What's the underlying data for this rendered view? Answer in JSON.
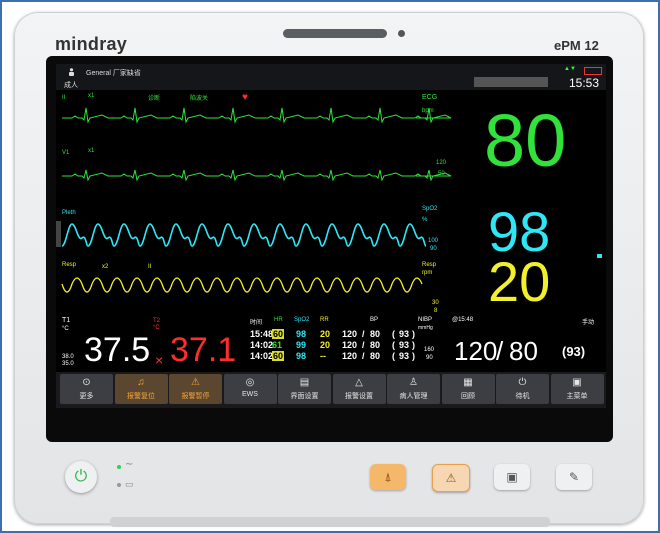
{
  "device": {
    "brand": "mindray",
    "model": "ePM 12"
  },
  "status_bar": {
    "patient_type": "成人",
    "bed_label": "General 厂家缺省",
    "time": "15:53"
  },
  "ecg": {
    "lead1": "II",
    "gain1": "x1",
    "filter": "诊断",
    "notch": "陷波关",
    "lead2": "V1",
    "gain2": "x1",
    "label": "ECG",
    "unit": "bpm",
    "upper": "120",
    "lower": "50",
    "hr": "80"
  },
  "spo2": {
    "wave_label": "Pleth",
    "label": "SpO2",
    "unit": "%",
    "upper": "100",
    "lower": "90",
    "value": "98"
  },
  "resp": {
    "wave_label": "Resp",
    "gain": "x2",
    "lead": "II",
    "label": "Resp",
    "unit": "rpm",
    "upper": "30",
    "lower": "8",
    "value": "20"
  },
  "temp": {
    "label": "T1",
    "unit": "°C",
    "upper": "38.0",
    "lower": "35.0",
    "t1": "37.5",
    "t2_label": "T2",
    "t2_unit": "°C",
    "t2": "37.1",
    "alarm_mark": "×"
  },
  "trend_table": {
    "headers": [
      "时间",
      "HR",
      "SpO2",
      "RR",
      "BP"
    ],
    "rows": [
      {
        "time": "15:48",
        "hr": "60",
        "spo2": "98",
        "rr": "20",
        "sys": "120",
        "sep": "/",
        "dia": "80",
        "paren": "(",
        "map": "93",
        "close": ")"
      },
      {
        "time": "14:02",
        "hr": "61",
        "spo2": "99",
        "rr": "20",
        "sys": "120",
        "sep": "/",
        "dia": "80",
        "paren": "(",
        "map": "93",
        "close": ")"
      },
      {
        "time": "14:02",
        "hr": "60",
        "spo2": "98",
        "rr": "--",
        "sys": "120",
        "sep": "/",
        "dia": "80",
        "paren": "(",
        "map": "93",
        "close": ")"
      }
    ]
  },
  "nibp": {
    "label": "NIBP",
    "unit": "mmHg",
    "time": "@15:48",
    "mode": "手动",
    "upper": "160",
    "lower": "90",
    "sys": "120",
    "sep": "/",
    "dia": "80",
    "map": "(93)"
  },
  "menu": [
    {
      "icon": "more-icon",
      "glyph": "⊙",
      "label": "更多"
    },
    {
      "icon": "alarm-reset-icon",
      "glyph": "♫",
      "label": "报警复位"
    },
    {
      "icon": "alarm-pause-icon",
      "glyph": "⚠",
      "label": "报警暂停"
    },
    {
      "icon": "ews-icon",
      "glyph": "◎",
      "label": "EWS"
    },
    {
      "icon": "screen-setup-icon",
      "glyph": "▤",
      "label": "界面设置"
    },
    {
      "icon": "alarm-setup-icon",
      "glyph": "△",
      "label": "报警设置"
    },
    {
      "icon": "patient-manage-icon",
      "glyph": "♙",
      "label": "病人管理"
    },
    {
      "icon": "review-icon",
      "glyph": "▦",
      "label": "回顾"
    },
    {
      "icon": "standby-icon",
      "glyph": "⏻",
      "label": "待机"
    },
    {
      "icon": "main-menu-icon",
      "glyph": "▣",
      "label": "主菜单"
    }
  ],
  "colors": {
    "hr": "#31e23a",
    "spo2": "#2ee6f5",
    "resp": "#f1f02a",
    "alarm": "#ff2e2e",
    "active_menu": "#f4a63a"
  }
}
